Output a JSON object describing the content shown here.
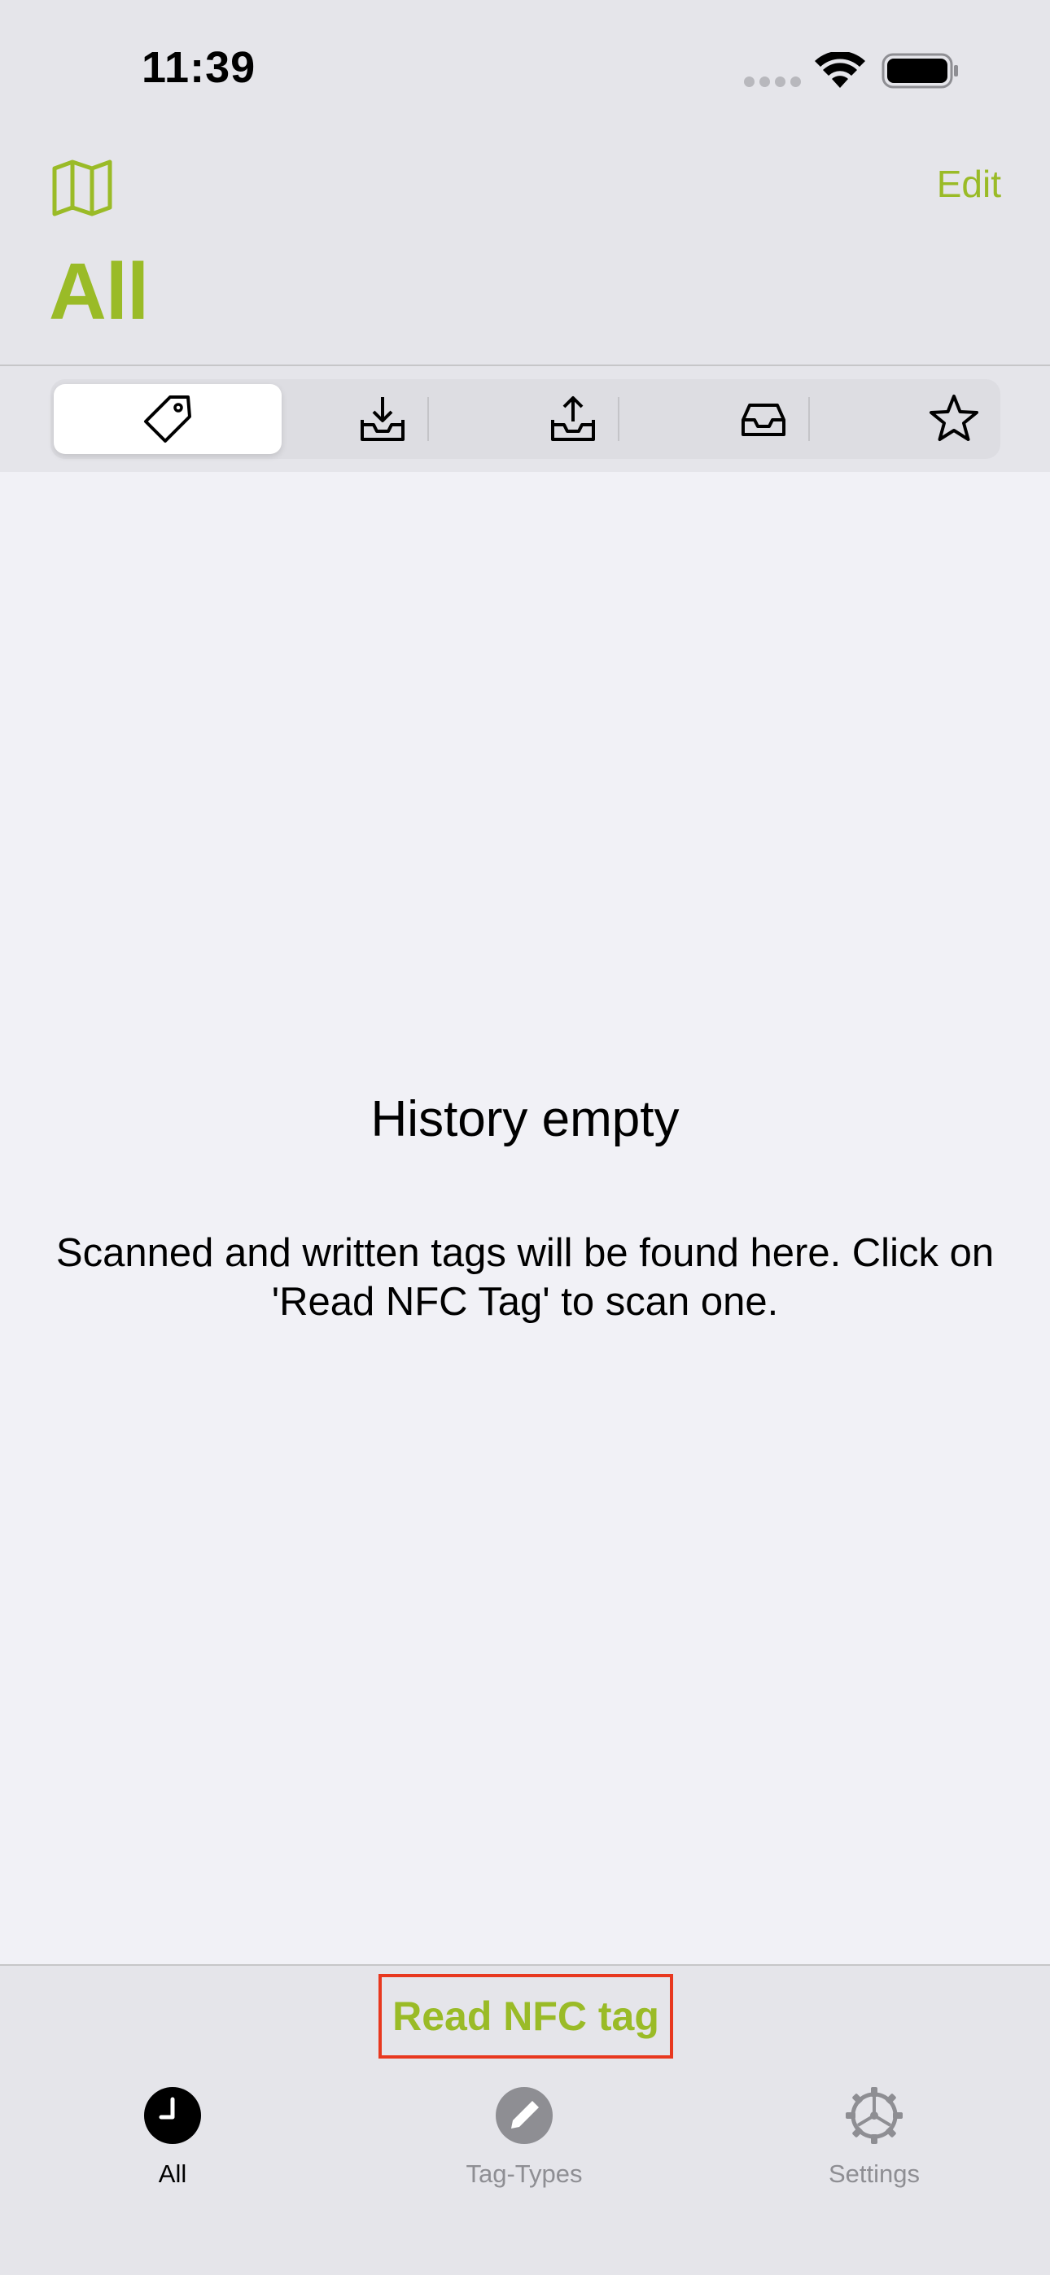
{
  "status_bar": {
    "time": "11:39",
    "signal_icon": "cellular-signal-dots-icon",
    "wifi_icon": "wifi-icon",
    "battery_icon": "battery-full-icon"
  },
  "nav": {
    "map_icon": "map-icon",
    "edit_label": "Edit",
    "title": "All"
  },
  "segments": [
    {
      "icon": "tag-icon",
      "selected": true
    },
    {
      "icon": "tray-download-icon",
      "selected": false
    },
    {
      "icon": "tray-upload-icon",
      "selected": false
    },
    {
      "icon": "tray-icon",
      "selected": false
    },
    {
      "icon": "star-icon",
      "selected": false
    }
  ],
  "empty_state": {
    "title": "History empty",
    "description": "Scanned and written tags will be found here. Click on 'Read NFC Tag' to scan one."
  },
  "action": {
    "read_label": "Read NFC tag"
  },
  "tabs": [
    {
      "label": "All",
      "icon": "clock-icon",
      "active": true
    },
    {
      "label": "Tag-Types",
      "icon": "pencil-icon",
      "active": false
    },
    {
      "label": "Settings",
      "icon": "gear-icon",
      "active": false
    }
  ],
  "colors": {
    "accent": "#9abb27",
    "highlight_border": "#e8381f",
    "background": "#f1f1f6",
    "bar_background": "#e5e5ea"
  }
}
